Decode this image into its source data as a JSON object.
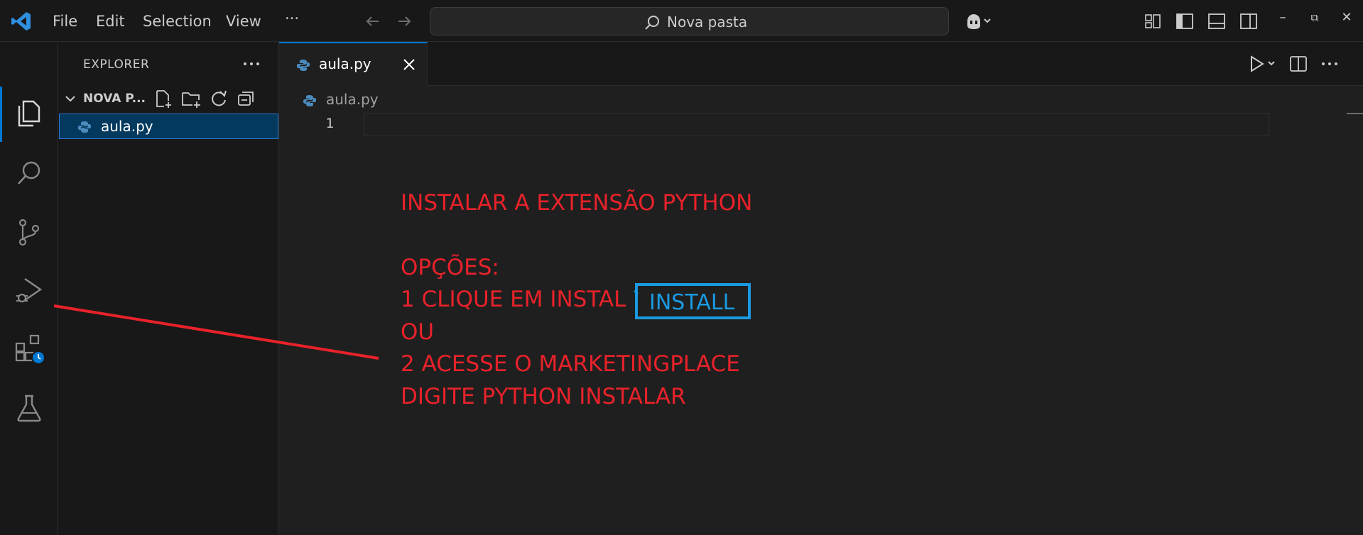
{
  "titlebar": {
    "menus": [
      "File",
      "Edit",
      "Selection",
      "View"
    ],
    "more": "···",
    "search_text": "Nova pasta",
    "win_minimize": "–",
    "win_restore": "⧉",
    "win_close": "✕"
  },
  "sidebar": {
    "title": "EXPLORER",
    "folder": "NOVA P...",
    "file": "aula.py"
  },
  "editor": {
    "tab_label": "aula.py",
    "breadcrumb": "aula.py",
    "line_number": "1"
  },
  "annotation": {
    "line1": "INSTALAR A EXTENSÃO PYTHON",
    "line2": "OPÇÕES:",
    "line3": "1 CLIQUE EM INSTAL",
    "line4": "OU",
    "line5": "2 ACESSE O MARKETINGPLACE",
    "line6": "DIGITE PYTHON INSTALAR",
    "install_button": "INSTALL"
  },
  "colors": {
    "accent": "#0078d4",
    "annotation_red": "#e8222a",
    "install_blue": "#1a9ae0",
    "selected_file_bg": "#04395e"
  }
}
